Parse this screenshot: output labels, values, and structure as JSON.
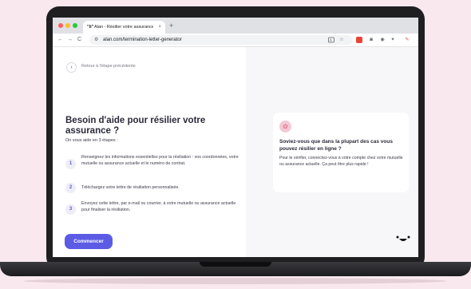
{
  "browser": {
    "tab_favicon": "\"li\"",
    "tab_title": "Alan - Résilier votre assurance",
    "tab_close": "×",
    "new_tab": "+",
    "back": "←",
    "forward": "→",
    "reload": "C",
    "url": "alan.com/termination-letter-generator",
    "extensions": [
      "translate-icon",
      "star-icon",
      "pdf-extension-icon",
      "camera-extension-icon",
      "extension-icon",
      "puzzle-icon",
      "chili-extension-icon"
    ]
  },
  "page": {
    "back_link": "Retour à l'étape précédente",
    "title": "Besoin d'aide pour résilier votre assurance ?",
    "subtitle": "On vous aide en 3 étapes :",
    "steps": [
      {
        "number": "1",
        "text": "Renseignez les informations essentielles pour la résiliation : vos coordonnées, votre mutuelle ou assurance actuelle et le numéro de contrat."
      },
      {
        "number": "2",
        "text": "Téléchargez votre lettre de résiliation personnalisée."
      },
      {
        "number": "3",
        "text": "Envoyez cette lettre, par e-mail ou courrier, à votre mutuelle ou assurance actuelle pour finaliser la résiliation."
      }
    ],
    "cta_label": "Commencer"
  },
  "info_card": {
    "title": "Soviez-vous que dans la plupart des cas vous pouvez résilier en ligne ?",
    "text": "Pour le vérifier, connectez-vous à votre compte chez votre mutuelle ou assurance actuelle. Ça peut être plus rapide !"
  },
  "colors": {
    "accent": "#5b5be6",
    "background": "#f9e9ee",
    "card_icon": "#f4c8d4"
  }
}
